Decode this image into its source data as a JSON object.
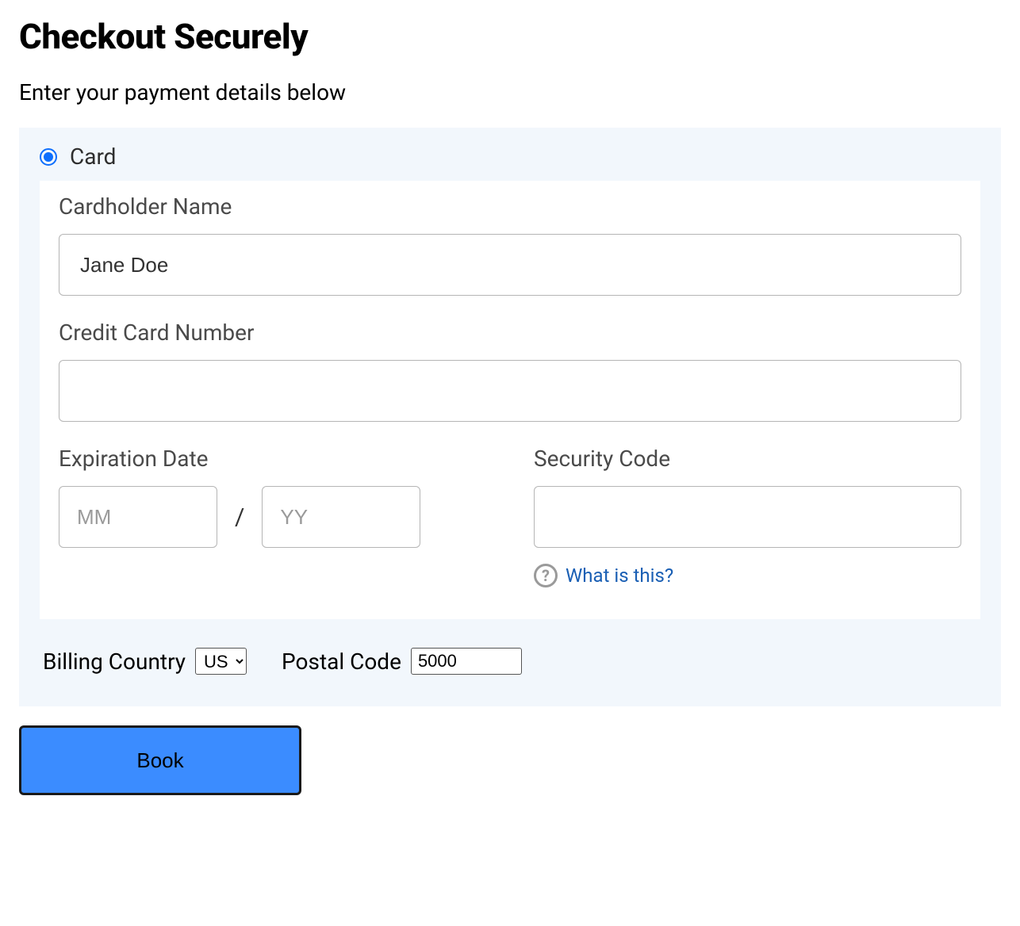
{
  "header": {
    "title": "Checkout Securely",
    "subtitle": "Enter your payment details below"
  },
  "payment": {
    "method_label": "Card",
    "cardholder": {
      "label": "Cardholder Name",
      "value": "Jane Doe"
    },
    "card_number": {
      "label": "Credit Card Number",
      "value": ""
    },
    "expiry": {
      "label": "Expiration Date",
      "mm_placeholder": "MM",
      "yy_placeholder": "YY",
      "separator": "/"
    },
    "cvv": {
      "label": "Security Code",
      "value": "",
      "help_text": "What is this?",
      "help_glyph": "?"
    }
  },
  "billing": {
    "country_label": "Billing Country",
    "country_value": "US",
    "postal_label": "Postal Code",
    "postal_value": "5000"
  },
  "actions": {
    "book_label": "Book"
  }
}
